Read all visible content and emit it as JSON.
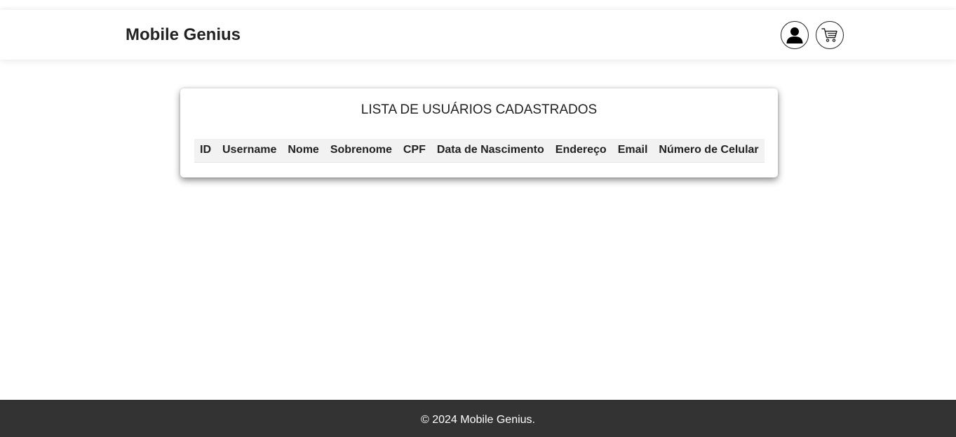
{
  "header": {
    "brand": "Mobile Genius",
    "icons": [
      "user-icon",
      "cart-icon"
    ]
  },
  "main": {
    "title": "LISTA DE USUÁRIOS CADASTRADOS",
    "table": {
      "columns": [
        "ID",
        "Username",
        "Nome",
        "Sobrenome",
        "CPF",
        "Data de Nascimento",
        "Endereço",
        "Email",
        "Número de Celular"
      ],
      "rows": []
    }
  },
  "footer": {
    "text": "© 2024 Mobile Genius."
  },
  "colors": {
    "footer_bg": "#333333",
    "table_header_bg": "#f2f2f2",
    "text": "#222222"
  }
}
